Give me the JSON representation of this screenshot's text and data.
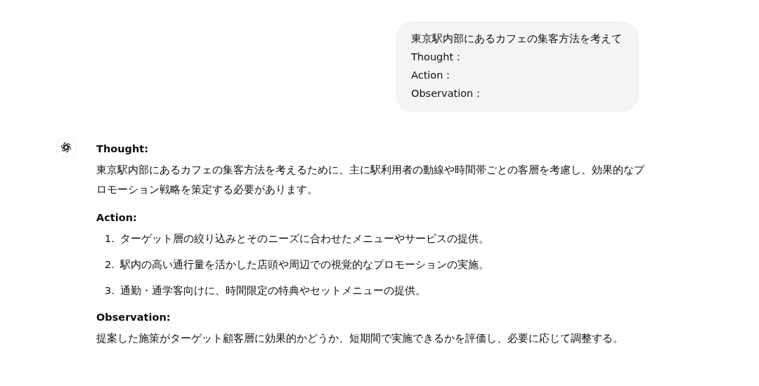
{
  "user_message": {
    "lines": [
      "東京駅内部にあるカフェの集客方法を考えて",
      "Thought：",
      "Action：",
      "Observation："
    ]
  },
  "assistant_message": {
    "sections": [
      {
        "kind": "paragraph",
        "heading": "Thought:",
        "text": "東京駅内部にあるカフェの集客方法を考えるために、主に駅利用者の動線や時間帯ごとの客層を考慮し、効果的なプロモーション戦略を策定する必要があります。"
      },
      {
        "kind": "list",
        "heading": "Action:",
        "items": [
          {
            "number": "1.",
            "text": "ターゲット層の絞り込みとそのニーズに合わせたメニューやサービスの提供。"
          },
          {
            "number": "2.",
            "text": "駅内の高い通行量を活かした店頭や周辺での視覚的なプロモーションの実施。"
          },
          {
            "number": "3.",
            "text": "通勤・通学客向けに、時間限定の特典やセットメニューの提供。"
          }
        ]
      },
      {
        "kind": "paragraph",
        "heading": "Observation:",
        "text": "提案した施策がターゲット顧客層に効果的かどうか、短期間で実施できるかを評価し、必要に応じて調整する。"
      }
    ]
  }
}
